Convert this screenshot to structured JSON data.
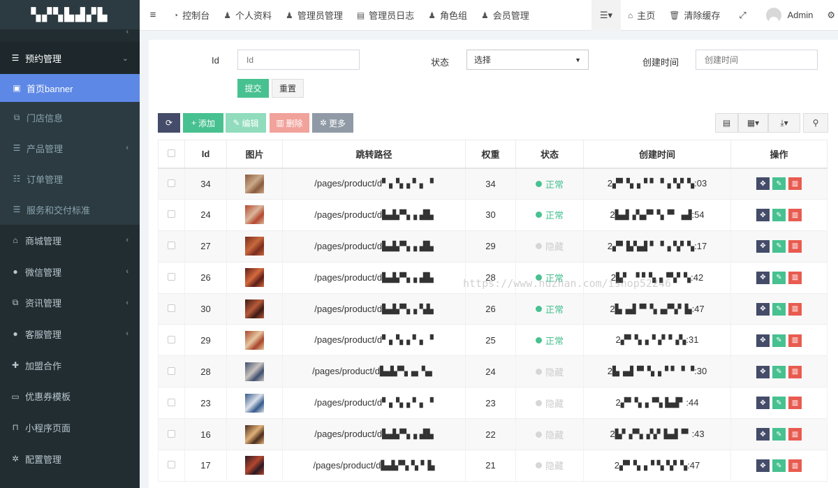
{
  "sidebar": {
    "logo": "▚▞▚▙▟▞▙",
    "open_group": {
      "label": "预约管理",
      "icon": "list-icon"
    },
    "submenu": [
      {
        "label": "首页banner",
        "icon": "image-icon",
        "active": true
      },
      {
        "label": "门店信息",
        "icon": "clone-icon",
        "active": false
      },
      {
        "label": "产品管理",
        "icon": "list-icon",
        "active": false,
        "has_children": true
      },
      {
        "label": "订单管理",
        "icon": "list-alt-icon",
        "active": false
      },
      {
        "label": "服务和交付标准",
        "icon": "server-icon",
        "active": false
      }
    ],
    "items": [
      {
        "label": "商城管理",
        "icon": "shop-icon",
        "has_children": true
      },
      {
        "label": "微信管理",
        "icon": "wechat-icon",
        "has_children": true
      },
      {
        "label": "资讯管理",
        "icon": "copy-icon",
        "has_children": true
      },
      {
        "label": "客服管理",
        "icon": "comment-icon",
        "has_children": true
      },
      {
        "label": "加盟合作",
        "icon": "user-plus-icon",
        "has_children": false
      },
      {
        "label": "优惠券模板",
        "icon": "money-icon",
        "has_children": false
      },
      {
        "label": "小程序页面",
        "icon": "bookmark-icon",
        "has_children": false
      },
      {
        "label": "配置管理",
        "icon": "gear-icon",
        "has_children": false
      }
    ]
  },
  "topbar": {
    "nav": [
      {
        "label": "控制台",
        "icon": "dashboard-icon"
      },
      {
        "label": "个人资料",
        "icon": "user-icon"
      },
      {
        "label": "管理员管理",
        "icon": "user-icon"
      },
      {
        "label": "管理员日志",
        "icon": "list-alt-icon"
      },
      {
        "label": "角色组",
        "icon": "group-icon"
      },
      {
        "label": "会员管理",
        "icon": "user-icon"
      }
    ],
    "home": "主页",
    "clear_cache": "清除缓存",
    "user": "Admin"
  },
  "search": {
    "id_label": "Id",
    "id_placeholder": "Id",
    "status_label": "状态",
    "status_value": "选择",
    "created_label": "创建时间",
    "created_placeholder": "创建时间",
    "submit": "提交",
    "reset": "重置"
  },
  "toolbar": {
    "add": "添加",
    "edit": "编辑",
    "delete": "删除",
    "more": "更多"
  },
  "table": {
    "headers": [
      "Id",
      "图片",
      "跳转路径",
      "权重",
      "状态",
      "创建时间",
      "操作"
    ],
    "rows": [
      {
        "id": "34",
        "path": "/pages/product/d▘▖▚▗ ▘▖▝",
        "weight": "34",
        "status": "正常",
        "on": true,
        "created": "2▞▘▚▗▝ ▘▝▗ ▚▘▚:03",
        "thumb": [
          "#8a5a3c",
          "#c9a98a"
        ]
      },
      {
        "id": "24",
        "path": "/pages/product/d▙▟▞▚▗ ▟▙",
        "weight": "30",
        "status": "正常",
        "on": true,
        "created": "2▙▟▗▚▞▘▚▝▘▗▟:54",
        "thumb": [
          "#b4472f",
          "#d9b79b"
        ]
      },
      {
        "id": "27",
        "path": "/pages/product/d▙▟▞▚▗ ▟▙",
        "weight": "29",
        "status": "隐藏",
        "on": false,
        "created": "2▞▘▙▚▟ ▘▝▗ ▚▘▚:17",
        "thumb": [
          "#7a2c1f",
          "#c8683c"
        ]
      },
      {
        "id": "26",
        "path": "/pages/product/d▙▟▞▚▗ ▟▙",
        "weight": "28",
        "status": "正常",
        "on": true,
        "created": "2▙▘ ▝ ▘▚▗▝▚▘▚:42",
        "thumb": [
          "#5b1d18",
          "#d56a3e"
        ]
      },
      {
        "id": "30",
        "path": "/pages/product/d▙▟▞▚▗ ▚▙",
        "weight": "26",
        "status": "正常",
        "on": true,
        "created": "2▙▗▟▝▘▚▗▞▚▘▙:47",
        "thumb": [
          "#3c1a14",
          "#b85a3a"
        ]
      },
      {
        "id": "29",
        "path": "/pages/product/d▘▖▚▗ ▘▖▝",
        "weight": "25",
        "status": "正常",
        "on": true,
        "created": "2▞▘▚▗▝ ▞▝▗▚:31",
        "thumb": [
          "#a8452c",
          "#e6c7a0"
        ]
      },
      {
        "id": "28",
        "path": "/pages/product/d▙▟▞▚▗▖▚▖",
        "weight": "24",
        "status": "隐藏",
        "on": false,
        "created": "2▙▗▟▝▘▚▗▝ ▘▝ ▝:30",
        "thumb": [
          "#3e4f6e",
          "#c9c2bd"
        ]
      },
      {
        "id": "23",
        "path": "/pages/product/d▘▖▚▗ ▘▖▝",
        "weight": "23",
        "status": "隐藏",
        "on": false,
        "created": "2▞▘▚▗▝▚ ▙▟▘:44",
        "thumb": [
          "#355a8a",
          "#dbe0ea"
        ]
      },
      {
        "id": "16",
        "path": "/pages/product/d▙▟▞▚▗ ▟▙",
        "weight": "22",
        "status": "隐藏",
        "on": false,
        "created": "2▙▘▞▚▗▚▘▙▟▝▘:43",
        "thumb": [
          "#4a2c1c",
          "#e0b078"
        ]
      },
      {
        "id": "17",
        "path": "/pages/product/d▙▟▞▚ ▚ ▘▙",
        "weight": "21",
        "status": "隐藏",
        "on": false,
        "created": "2▞▘▚▗▝ ▚ ▚▘▚:47",
        "thumb": [
          "#2a1a24",
          "#b4462e"
        ]
      }
    ]
  },
  "watermark": "https://www.huzhan.com/ishop52246",
  "colors": {
    "sidebar_bg": "#222d32",
    "active": "#5d88e6",
    "success": "#47c190",
    "danger": "#e85b50",
    "primary_dark": "#444c69"
  }
}
